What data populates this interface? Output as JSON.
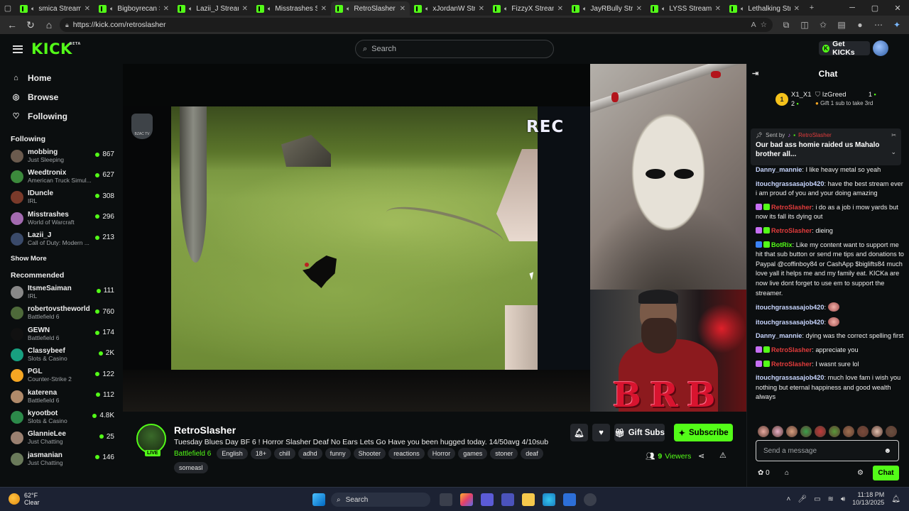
{
  "browser": {
    "tabs": [
      {
        "title": "smica Stream",
        "active": false
      },
      {
        "title": "Bigboyrecan St",
        "active": false
      },
      {
        "title": "Lazii_J Stream",
        "active": false
      },
      {
        "title": "Misstrashes St",
        "active": false
      },
      {
        "title": "RetroSlasher S",
        "active": true
      },
      {
        "title": "xJordanW Stre",
        "active": false
      },
      {
        "title": "FizzyX Stream",
        "active": false
      },
      {
        "title": "JayRBully Stre",
        "active": false
      },
      {
        "title": "LYSS Stream",
        "active": false
      },
      {
        "title": "Lethalking Stre",
        "active": false
      }
    ],
    "url": "https://kick.com/retroslasher"
  },
  "header": {
    "logo": "KICK",
    "logo_badge": "BETA",
    "search_placeholder": "Search",
    "get_kicks": "Get KICKs"
  },
  "sidebar": {
    "nav": [
      {
        "label": "Home",
        "icon": "home-icon"
      },
      {
        "label": "Browse",
        "icon": "compass-icon"
      },
      {
        "label": "Following",
        "icon": "heart-icon"
      }
    ],
    "following_heading": "Following",
    "following": [
      {
        "name": "mobbing",
        "category": "Just Sleeping",
        "viewers": "867",
        "color": "#6b5b4e"
      },
      {
        "name": "Weedtronix",
        "category": "American Truck Simul...",
        "viewers": "627",
        "color": "#3c8a3c"
      },
      {
        "name": "IDuncle",
        "category": "IRL",
        "viewers": "308",
        "color": "#7a3a2a"
      },
      {
        "name": "Misstrashes",
        "category": "World of Warcraft",
        "viewers": "296",
        "color": "#a36ab0"
      },
      {
        "name": "Lazii_J",
        "category": "Call of Duty: Modern ...",
        "viewers": "213",
        "color": "#3a4a6a"
      }
    ],
    "show_more": "Show More",
    "recommended_heading": "Recommended",
    "recommended": [
      {
        "name": "ItsmeSaiman",
        "category": "IRL",
        "viewers": "111",
        "color": "#888"
      },
      {
        "name": "robertovstheworld",
        "category": "Battlefield 6",
        "viewers": "760",
        "color": "#4e6a3a"
      },
      {
        "name": "GEWN",
        "category": "Battlefield 6",
        "viewers": "174",
        "color": "#111"
      },
      {
        "name": "Classybeef",
        "category": "Slots & Casino",
        "viewers": "2K",
        "color": "#18a080"
      },
      {
        "name": "PGL",
        "category": "Counter-Strike 2",
        "viewers": "122",
        "color": "#f5a623"
      },
      {
        "name": "katerena",
        "category": "Battlefield 6",
        "viewers": "112",
        "color": "#b08a6a"
      },
      {
        "name": "kyootbot",
        "category": "Slots & Casino",
        "viewers": "4.8K",
        "color": "#2c8a4a"
      },
      {
        "name": "GlannieLee",
        "category": "Just Chatting",
        "viewers": "25",
        "color": "#9a8070"
      },
      {
        "name": "jasmanian",
        "category": "Just Chatting",
        "viewers": "146",
        "color": "#6a7a5a"
      }
    ]
  },
  "video": {
    "overlay_text": "REC",
    "watermark": "BZAC TV",
    "cam_overlay": "BRB"
  },
  "stream": {
    "channel": "RetroSlasher",
    "live_badge": "LIVE",
    "title": "Tuesday Blues Day  BF 6 ! Horror Slasher Deaf No Ears Lets Go Have you been hugged today. 14/50avg 4/10sub",
    "category": "Battlefield 6",
    "tags": [
      "English",
      "18+",
      "chill",
      "adhd",
      "funny",
      "Shooter",
      "reactions",
      "Horror",
      "games",
      "stoner",
      "deaf",
      "someasl"
    ],
    "gift_subs": "Gift Subs",
    "subscribe": "Subscribe",
    "viewers_count": "9",
    "viewers_label": "Viewers"
  },
  "chat": {
    "title": "Chat",
    "leaderboard": [
      {
        "rank": "1",
        "name": "X1_X1",
        "value": "2"
      },
      {
        "name": "IzGreed",
        "value": "1"
      }
    ],
    "leaderboard_hint": "Gift 1 sub to take 3rd",
    "pinned": {
      "sent_by_label": "Sent by",
      "sender": "RetroSlasher",
      "message": "Our bad ass homie raided us Mahalo brother all..."
    },
    "messages": [
      {
        "user": "Danny_mannie",
        "text": "I like heavy metal so yeah",
        "style": "b"
      },
      {
        "user": "itouchgrassasajob420",
        "text": "have the best stream ever i am proud of you and your doing amazing",
        "style": "b"
      },
      {
        "user": "RetroSlasher",
        "text": "i do as a job i mow yards but now its fall its dying out",
        "style": "r"
      },
      {
        "user": "RetroSlasher",
        "text": "dieing",
        "style": "r"
      },
      {
        "user": "BotRix",
        "text": "Like my content want to support me hit that sub button or send me tips and donations to Paypal @coffinboy84 or CashApp $biglifts84 much love yall it helps me and my family eat. KICKa are now live dont forget to use em to support the streamer.",
        "style": "g"
      },
      {
        "user": "itouchgrassasajob420",
        "text": "",
        "style": "b",
        "emote": true
      },
      {
        "user": "itouchgrassasajob420",
        "text": "",
        "style": "b",
        "emote": true
      },
      {
        "user": "Danny_mannie",
        "text": "dying was the correct spelling first",
        "style": "b"
      },
      {
        "user": "RetroSlasher",
        "text": "appreciate you",
        "style": "r"
      },
      {
        "user": "RetroSlasher",
        "text": "I wasnt sure lol",
        "style": "r"
      },
      {
        "user": "itouchgrassasajob420",
        "text": "much love fam i wish you nothing but eternal happiness and good wealth always",
        "style": "b"
      }
    ],
    "input_placeholder": "Send a message",
    "kicks_balance": "0",
    "chat_button": "Chat"
  },
  "taskbar": {
    "temperature": "62°F",
    "condition": "Clear",
    "search": "Search",
    "time": "11:18 PM",
    "date": "10/13/2025"
  }
}
